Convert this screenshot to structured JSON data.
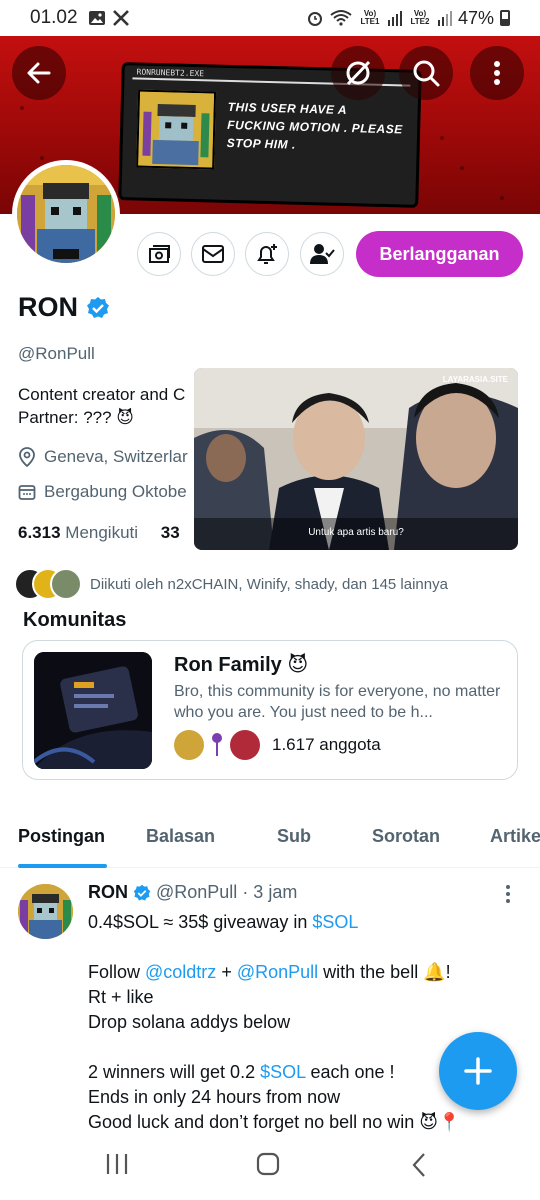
{
  "status_bar": {
    "time": "01.02",
    "battery": "47%",
    "net1": "Vo) LTE1",
    "net2": "Vo) LTE2"
  },
  "banner": {
    "meme_window_title": "RONRUNEBT2.EXE",
    "meme_text": "THIS USER HAVE A FUCKING MOTION . PLEASE STOP HIM ."
  },
  "profile": {
    "name": "RON",
    "handle": "@RonPull",
    "bio_line1": "Content creator and C",
    "bio_line2": "Partner: ??? 😈",
    "location": "Geneva, Switzerlar",
    "joined": "Bergabung Oktobe",
    "following_count": "6.313",
    "following_label": "Mengikuti",
    "followers_partial": "33",
    "subscribe_label": "Berlangganan",
    "followed_by": "Diikuti oleh n2xCHAIN, Winify, shady, dan 145 lainnya"
  },
  "video": {
    "watermark": "LAYARASIA.SITE",
    "subtitle": "Untuk apa artis baru?"
  },
  "community": {
    "section_title": "Komunitas",
    "name": "Ron Family 😈",
    "description": "Bro, this community is for everyone, no matter who you are. You just need to be h...",
    "members": "1.617 anggota"
  },
  "tabs": [
    "Postingan",
    "Balasan",
    "Sub",
    "Sorotan",
    "Artike"
  ],
  "post": {
    "name": "RON",
    "handle": "@RonPull",
    "time": "· 3 jam",
    "line1_a": "0.4$SOL ≈ 35$ giveaway in ",
    "line1_link": "$SOL",
    "line2_a": "Follow ",
    "line2_link1": "@coldtrz",
    "line2_b": " + ",
    "line2_link2": "@RonPull",
    "line2_c": " with the bell 🔔!",
    "line3": "Rt + like",
    "line4": "Drop solana addys below",
    "line5_a": "2 winners will get 0.2 ",
    "line5_link": "$SOL",
    "line5_b": " each one !",
    "line6": "Ends in only 24 hours from now",
    "line7": "Good luck and don’t forget no bell no win 😈📍"
  },
  "colors": {
    "accent": "#1d9bf0",
    "subscribe": "#c52ec8",
    "banner": "#b30d0d"
  }
}
